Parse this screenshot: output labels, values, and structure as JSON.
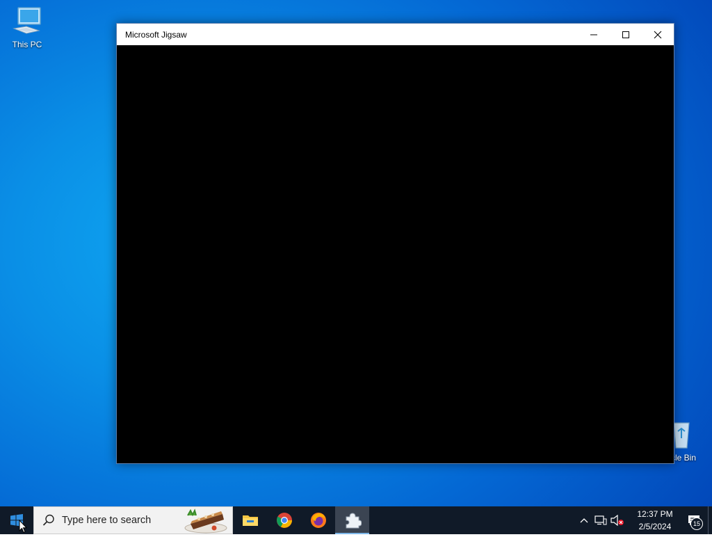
{
  "desktop": {
    "icons": [
      {
        "label": "This PC",
        "icon": "this-pc-icon"
      },
      {
        "label": "ycle Bin",
        "icon": "recycle-bin-icon"
      }
    ]
  },
  "window": {
    "title": "Microsoft Jigsaw",
    "controls": {
      "minimize": "minimize-icon",
      "maximize": "maximize-icon",
      "close": "close-icon"
    }
  },
  "taskbar": {
    "search_placeholder": "Type here to search",
    "apps": [
      {
        "name": "File Explorer",
        "icon": "folder-icon",
        "active": false
      },
      {
        "name": "Google Chrome",
        "icon": "chrome-icon",
        "active": false
      },
      {
        "name": "Firefox",
        "icon": "firefox-icon",
        "active": false
      },
      {
        "name": "Microsoft Jigsaw",
        "icon": "jigsaw-icon",
        "active": true
      }
    ],
    "clock": {
      "time": "12:37 PM",
      "date": "2/5/2024"
    },
    "notifications": {
      "count": "15"
    }
  },
  "colors": {
    "taskbar": "#101a28",
    "accent": "#7fb8ea",
    "desktop": "#0a8fe6"
  }
}
